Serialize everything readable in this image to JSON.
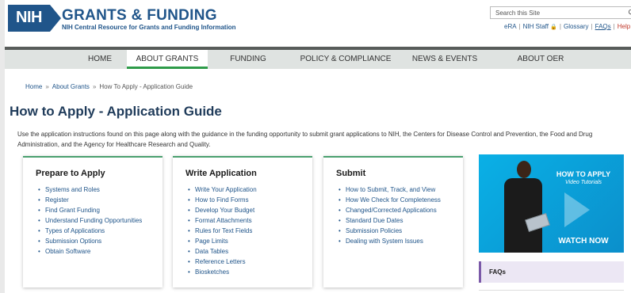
{
  "header": {
    "logo_text": "NIH",
    "title": "GRANTS & FUNDING",
    "subtitle": "NIH Central Resource for Grants and Funding Information",
    "search_placeholder": "Search this Site",
    "util_links": {
      "era": "eRA",
      "staff": "NIH Staff",
      "glossary": "Glossary",
      "faqs": "FAQs",
      "help": "Help"
    }
  },
  "nav": {
    "items": [
      {
        "label": "HOME"
      },
      {
        "label": "ABOUT GRANTS"
      },
      {
        "label": "FUNDING"
      },
      {
        "label": "POLICY & COMPLIANCE"
      },
      {
        "label": "NEWS & EVENTS"
      },
      {
        "label": "ABOUT OER"
      }
    ],
    "active_index": 1
  },
  "breadcrumb": {
    "home": "Home",
    "about": "About Grants",
    "current": "How To Apply - Application Guide",
    "separator": "»"
  },
  "page_title": "How to Apply - Application Guide",
  "intro": "Use the application instructions found on this page along with the guidance in the funding opportunity to submit grant applications to NIH, the Centers for Disease Control and Prevention, the Food and Drug Administration, and the Agency for Healthcare Research and Quality.",
  "cards": [
    {
      "title": "Prepare to Apply",
      "items": [
        "Systems and Roles",
        "Register",
        "Find Grant Funding",
        "Understand Funding Opportunities",
        "Types of Applications",
        "Submission Options",
        "Obtain Software"
      ]
    },
    {
      "title": "Write Application",
      "items": [
        "Write Your Application",
        "How to Find Forms",
        "Develop Your Budget",
        "Format Attachments",
        "Rules for Text Fields",
        "Page Limits",
        "Data Tables",
        "Reference Letters",
        "Biosketches"
      ]
    },
    {
      "title": "Submit",
      "items": [
        "How to Submit, Track, and View",
        "How We Check for Completeness",
        "Changed/Corrected Applications",
        "Standard Due Dates",
        "Submission Policies",
        "Dealing with System Issues"
      ]
    }
  ],
  "promo": {
    "title": "HOW TO APPLY",
    "subtitle": "Video Tutorials",
    "cta": "WATCH NOW"
  },
  "sidebar": {
    "faqs_label": "FAQs"
  },
  "colors": {
    "brand_blue": "#20558a",
    "nav_active_green": "#2e9b49",
    "card_accent_green": "#4aa06f",
    "promo_blue": "#0a9fd6",
    "faq_purple": "#7b59a8"
  }
}
